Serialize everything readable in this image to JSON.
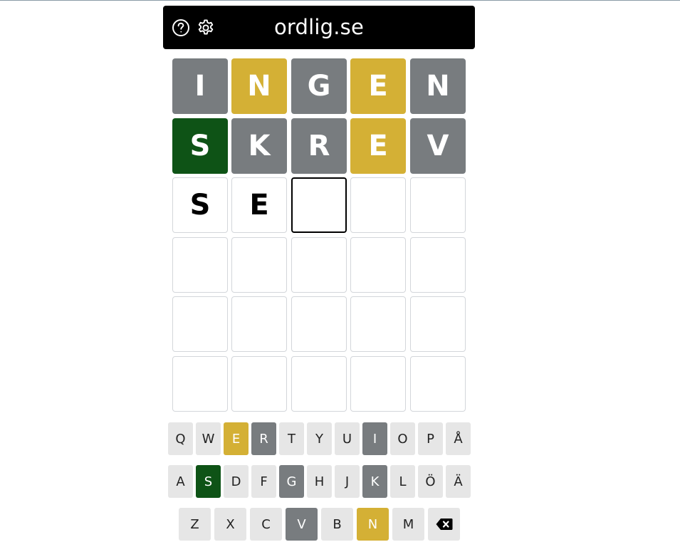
{
  "header": {
    "title": "ordlig.se",
    "help_icon": "help-circle-icon",
    "settings_icon": "gear-icon"
  },
  "colors": {
    "correct": "#0e5316",
    "present": "#d4b035",
    "absent": "#787c7f",
    "unused_key": "#e6e6e6",
    "header_bg": "#000000"
  },
  "board": {
    "rows": [
      [
        {
          "letter": "I",
          "state": "absent"
        },
        {
          "letter": "N",
          "state": "present"
        },
        {
          "letter": "G",
          "state": "absent"
        },
        {
          "letter": "E",
          "state": "present"
        },
        {
          "letter": "N",
          "state": "absent"
        }
      ],
      [
        {
          "letter": "S",
          "state": "correct"
        },
        {
          "letter": "K",
          "state": "absent"
        },
        {
          "letter": "R",
          "state": "absent"
        },
        {
          "letter": "E",
          "state": "present"
        },
        {
          "letter": "V",
          "state": "absent"
        }
      ],
      [
        {
          "letter": "S",
          "state": "typed"
        },
        {
          "letter": "E",
          "state": "typed"
        },
        {
          "letter": "",
          "state": "active"
        },
        {
          "letter": "",
          "state": "empty"
        },
        {
          "letter": "",
          "state": "empty"
        }
      ],
      [
        {
          "letter": "",
          "state": "empty"
        },
        {
          "letter": "",
          "state": "empty"
        },
        {
          "letter": "",
          "state": "empty"
        },
        {
          "letter": "",
          "state": "empty"
        },
        {
          "letter": "",
          "state": "empty"
        }
      ],
      [
        {
          "letter": "",
          "state": "empty"
        },
        {
          "letter": "",
          "state": "empty"
        },
        {
          "letter": "",
          "state": "empty"
        },
        {
          "letter": "",
          "state": "empty"
        },
        {
          "letter": "",
          "state": "empty"
        }
      ],
      [
        {
          "letter": "",
          "state": "empty"
        },
        {
          "letter": "",
          "state": "empty"
        },
        {
          "letter": "",
          "state": "empty"
        },
        {
          "letter": "",
          "state": "empty"
        },
        {
          "letter": "",
          "state": "empty"
        }
      ]
    ]
  },
  "keyboard": {
    "rows": [
      [
        {
          "label": "Q",
          "state": "unused"
        },
        {
          "label": "W",
          "state": "unused"
        },
        {
          "label": "E",
          "state": "present"
        },
        {
          "label": "R",
          "state": "absent"
        },
        {
          "label": "T",
          "state": "unused"
        },
        {
          "label": "Y",
          "state": "unused"
        },
        {
          "label": "U",
          "state": "unused"
        },
        {
          "label": "I",
          "state": "absent"
        },
        {
          "label": "O",
          "state": "unused"
        },
        {
          "label": "P",
          "state": "unused"
        },
        {
          "label": "Å",
          "state": "unused"
        }
      ],
      [
        {
          "label": "A",
          "state": "unused"
        },
        {
          "label": "S",
          "state": "correct"
        },
        {
          "label": "D",
          "state": "unused"
        },
        {
          "label": "F",
          "state": "unused"
        },
        {
          "label": "G",
          "state": "absent"
        },
        {
          "label": "H",
          "state": "unused"
        },
        {
          "label": "J",
          "state": "unused"
        },
        {
          "label": "K",
          "state": "absent"
        },
        {
          "label": "L",
          "state": "unused"
        },
        {
          "label": "Ö",
          "state": "unused"
        },
        {
          "label": "Ä",
          "state": "unused"
        }
      ],
      [
        {
          "label": "Z",
          "state": "unused"
        },
        {
          "label": "X",
          "state": "unused"
        },
        {
          "label": "C",
          "state": "unused"
        },
        {
          "label": "V",
          "state": "absent"
        },
        {
          "label": "B",
          "state": "unused"
        },
        {
          "label": "N",
          "state": "present"
        },
        {
          "label": "M",
          "state": "unused"
        },
        {
          "label": "",
          "state": "unused",
          "icon": "backspace-icon"
        }
      ]
    ]
  }
}
